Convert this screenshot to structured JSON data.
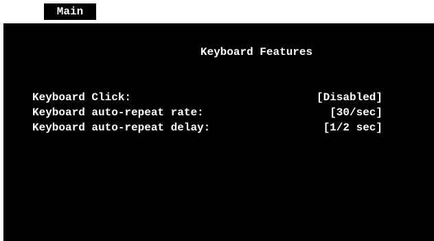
{
  "menu": {
    "tab_label": "Main"
  },
  "screen": {
    "title": "Keyboard Features",
    "settings": [
      {
        "label": "Keyboard Click:",
        "value": "[Disabled]"
      },
      {
        "label": "Keyboard auto-repeat rate:",
        "value": "[30/sec]"
      },
      {
        "label": "Keyboard auto-repeat delay:",
        "value": "[1/2 sec]"
      }
    ]
  },
  "colors": {
    "background": "#000000",
    "text": "#ffffff",
    "menu_bar": "#ffffff",
    "tab_background": "#000000"
  }
}
